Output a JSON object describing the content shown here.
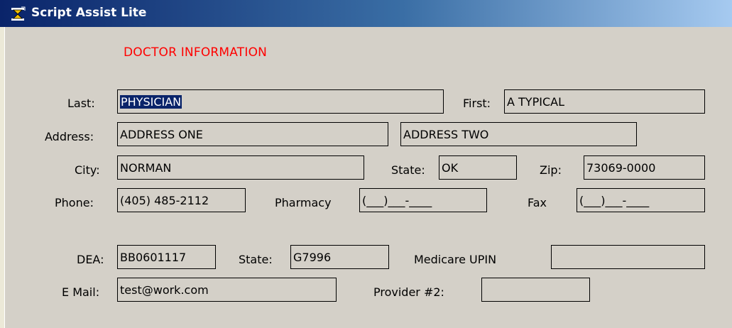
{
  "window": {
    "title": "Script Assist Lite"
  },
  "form": {
    "heading": "DOCTOR INFORMATION",
    "last_label": "Last:",
    "last_value": "PHYSICIAN",
    "first_label": "First:",
    "first_value": "A TYPICAL",
    "address_label": "Address:",
    "address1_value": "ADDRESS ONE",
    "address2_value": "ADDRESS TWO",
    "city_label": "City:",
    "city_value": "NORMAN",
    "state_label": "State:",
    "state_value": "OK",
    "zip_label": "Zip:",
    "zip_value": "73069-0000",
    "phone_label": "Phone:",
    "phone_value": "(405) 485-2112",
    "pharmacy_label": "Pharmacy",
    "pharmacy_value": "(___)___-____",
    "fax_label": "Fax",
    "fax_value": "(___)___-____",
    "dea_label": "DEA:",
    "dea_value": "BB0601117",
    "license_state_label": "State:",
    "license_state_value": "G7996",
    "upin_label": "Medicare UPIN",
    "upin_value": "",
    "email_label": "E Mail:",
    "email_value": "test@work.com",
    "provider2_label": "Provider #2:",
    "provider2_value": ""
  },
  "colors": {
    "heading": "#ff0000",
    "selection": "#0a246a",
    "face": "#d4d0c8"
  }
}
